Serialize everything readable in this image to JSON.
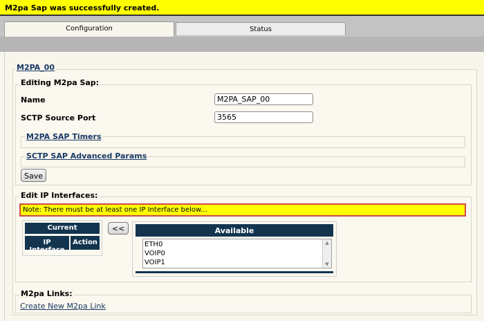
{
  "banner": {
    "message": "M2pa Sap was successfully created."
  },
  "tabs": [
    {
      "label": "Configuration",
      "active": true
    },
    {
      "label": "Status",
      "active": false
    }
  ],
  "sap": {
    "title": "M2PA_00",
    "editing_legend": "Editing M2pa Sap:",
    "name_label": "Name",
    "name_value": "M2PA_SAP_00",
    "port_label": "SCTP Source Port",
    "port_value": "3565",
    "timers_link": "M2PA SAP Timers",
    "advanced_link": "SCTP SAP Advanced Params",
    "save_label": "Save"
  },
  "ip": {
    "legend": "Edit IP Interfaces:",
    "note": "Note: There must be at least one IP Interface below...",
    "current_header": "Current",
    "col_interface": "IP Interface",
    "col_action": "Action",
    "move_button": "<<",
    "available_header": "Available",
    "available_options": [
      "ETH0",
      "VOIP0",
      "VOIP1"
    ]
  },
  "links": {
    "legend": "M2pa Links:",
    "create_link": "Create New M2pa Link"
  },
  "colors": {
    "banner": "#ffff00",
    "header_navy": "#12344f",
    "note_border": "#d24a4a",
    "page_bg": "#f7f5ec"
  }
}
